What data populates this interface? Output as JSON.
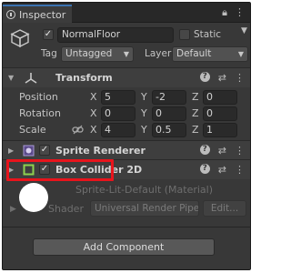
{
  "tab": {
    "label": "Inspector"
  },
  "object": {
    "active": true,
    "name": "NormalFloor",
    "static_label": "Static",
    "tag_label": "Tag",
    "tag_value": "Untagged",
    "layer_label": "Layer",
    "layer_value": "Default"
  },
  "transform": {
    "title": "Transform",
    "rows": [
      {
        "label": "Position",
        "x": "5",
        "y": "-2",
        "z": "0"
      },
      {
        "label": "Rotation",
        "x": "0",
        "y": "0",
        "z": "0"
      },
      {
        "label": "Scale",
        "x": "4",
        "y": "0.5",
        "z": "1"
      }
    ],
    "axes": {
      "x": "X",
      "y": "Y",
      "z": "Z"
    }
  },
  "sprite_renderer": {
    "title": "Sprite Renderer"
  },
  "box_collider": {
    "title": "Box Collider 2D"
  },
  "material": {
    "name": "Sprite-Lit-Default (Material)",
    "shader_label": "Shader",
    "shader_value": "Universal Render Pipe",
    "edit_label": "Edit..."
  },
  "add_component": {
    "label": "Add Component"
  },
  "colors": {
    "accent": "#3a72b0",
    "highlight": "#e8141c",
    "panel": "#383838"
  }
}
